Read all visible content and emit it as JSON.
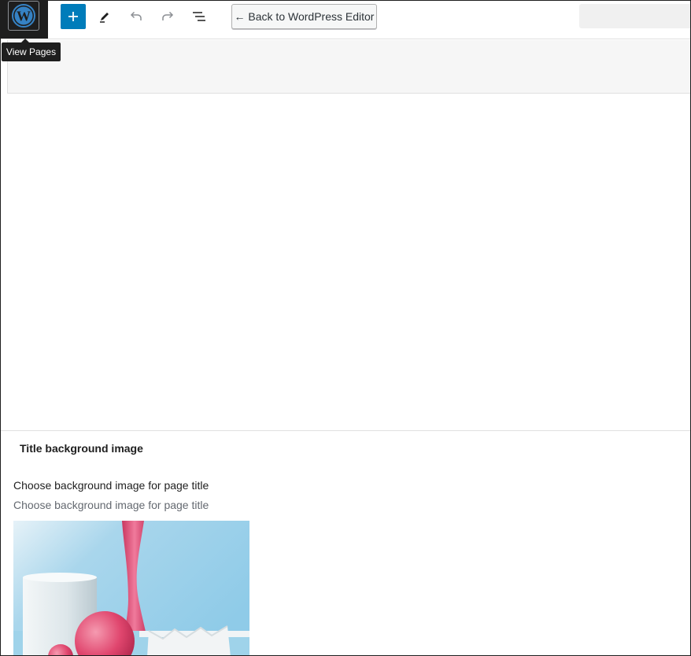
{
  "toolbar": {
    "wp_logo_icon": "wordpress-logo-icon",
    "add_block_icon": "plus-icon",
    "tools_icon": "pencil-icon",
    "undo_icon": "undo-icon",
    "redo_icon": "redo-icon",
    "list_view_icon": "list-view-icon",
    "back_button_label": "← Back to WordPress Editor"
  },
  "tooltip": {
    "text": "View Pages"
  },
  "meta_box": {
    "heading": "Title background image",
    "field_label": "Choose background image for page title",
    "field_description": "Choose background image for page title"
  },
  "colors": {
    "accent": "#007cba",
    "dark": "#1e1e1e",
    "muted_text": "#646970"
  }
}
